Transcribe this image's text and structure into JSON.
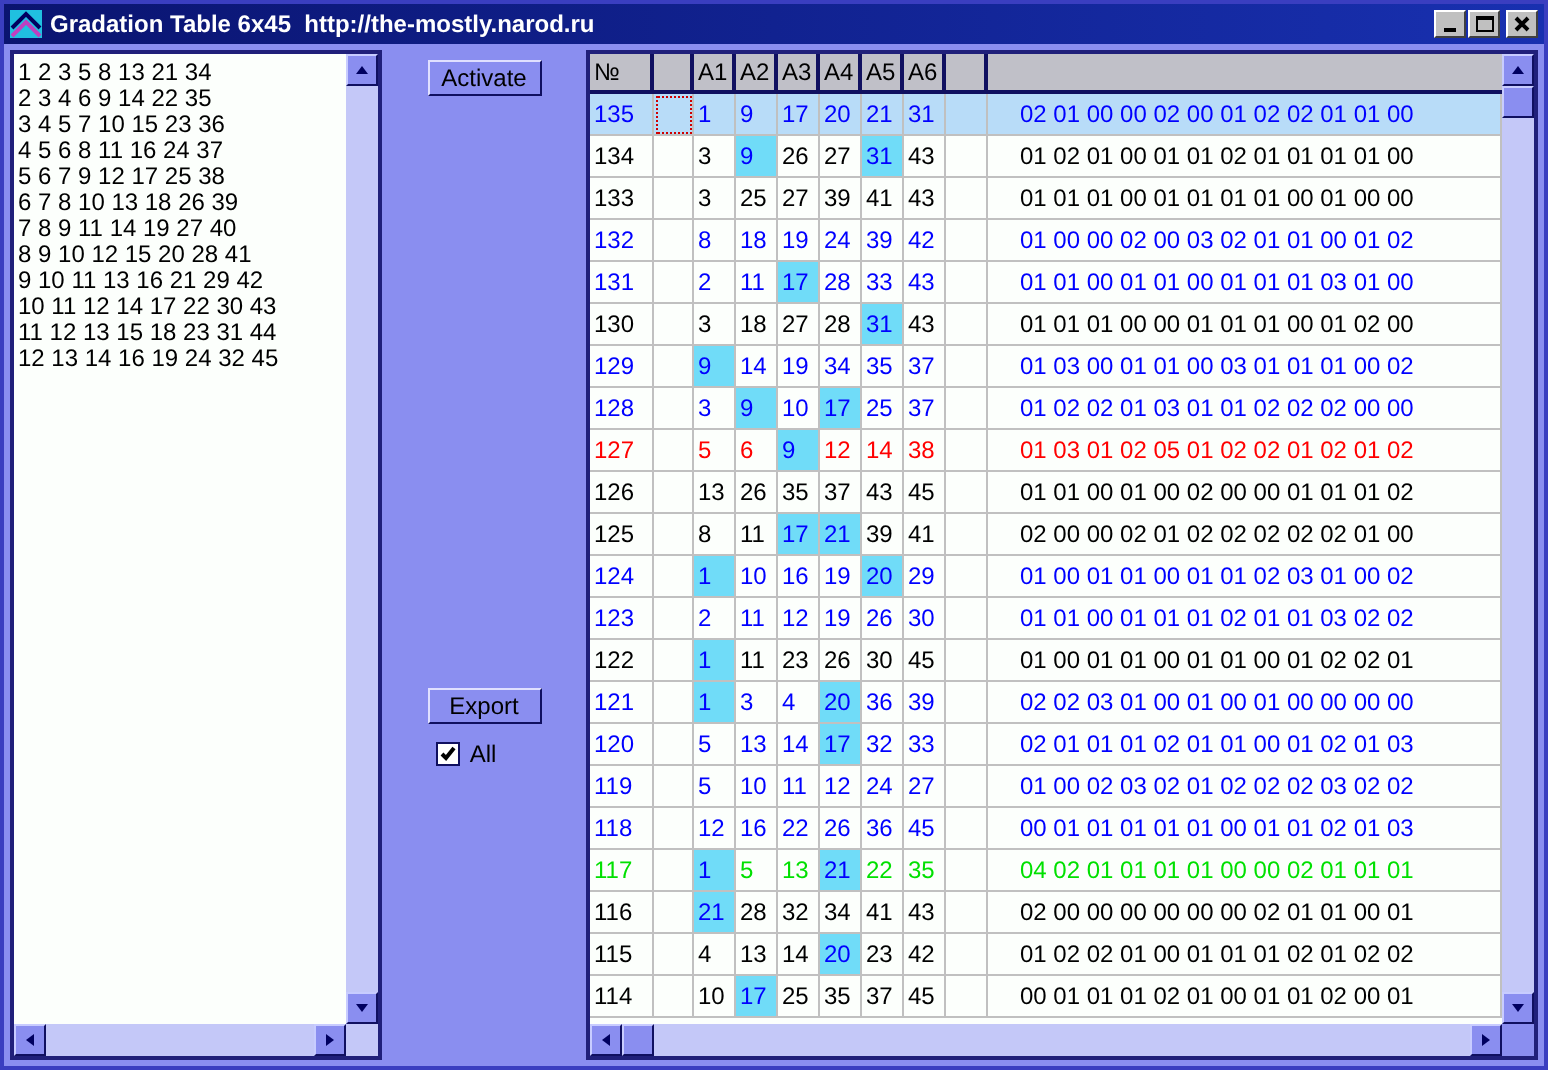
{
  "window": {
    "title": "Gradation Table 6x45  http://the-mostly.narod.ru"
  },
  "sequence_list": {
    "lines": [
      "1 2 3 5 8 13 21 34",
      "2 3 4 6 9 14 22 35",
      "3 4 5 7 10 15 23 36",
      "4 5 6 8 11 16 24 37",
      "5 6 7 9 12 17 25 38",
      "6 7 8 10 13 18 26 39",
      "7 8 9 11 14 19 27 40",
      "8 9 10 12 15 20 28 41",
      "9 10 11 13 16 21 29 42",
      "10 11 12 14 17 22 30 43",
      "11 12 13 15 18 23 31 44",
      "12 13 14 16 19 24 32 45"
    ]
  },
  "activate_button": "Activate",
  "export_button": "Export",
  "all_checkbox": {
    "label": "All",
    "checked": true
  },
  "table": {
    "columns": [
      "№",
      null,
      "A1",
      "A2",
      "A3",
      "A4",
      "A5",
      "A6",
      null,
      null
    ],
    "rows": [
      {
        "selected": true,
        "color": "#0000ff",
        "cells": [
          {
            "value": "135",
            "highlighted": false
          },
          {
            "highlighted": false
          },
          {
            "value": "1",
            "highlighted": false
          },
          {
            "value": "9",
            "highlighted": false
          },
          {
            "value": "17",
            "highlighted": false
          },
          {
            "value": "20",
            "highlighted": false
          },
          {
            "value": "21",
            "highlighted": false
          },
          {
            "value": "31",
            "highlighted": false
          },
          {
            "highlighted": false
          },
          {
            "value": "02 01 00 00 02 00 01 02 02 01 01 00",
            "highlighted": false
          }
        ]
      },
      {
        "selected": false,
        "color": "#000000",
        "cells": [
          {
            "value": "134",
            "highlighted": false
          },
          {
            "highlighted": false
          },
          {
            "value": "3",
            "highlighted": false
          },
          {
            "value": "9",
            "highlighted": true
          },
          {
            "value": "26",
            "highlighted": false
          },
          {
            "value": "27",
            "highlighted": false
          },
          {
            "value": "31",
            "highlighted": true
          },
          {
            "value": "43",
            "highlighted": false
          },
          {
            "highlighted": false
          },
          {
            "value": "01 02 01 00 01 01 02 01 01 01 01 00",
            "highlighted": false
          }
        ]
      },
      {
        "selected": false,
        "color": "#000000",
        "cells": [
          {
            "value": "133",
            "highlighted": false
          },
          {
            "highlighted": false
          },
          {
            "value": "3",
            "highlighted": false
          },
          {
            "value": "25",
            "highlighted": false
          },
          {
            "value": "27",
            "highlighted": false
          },
          {
            "value": "39",
            "highlighted": false
          },
          {
            "value": "41",
            "highlighted": false
          },
          {
            "value": "43",
            "highlighted": false
          },
          {
            "highlighted": false
          },
          {
            "value": "01 01 01 00 01 01 01 01 00 01 00 00",
            "highlighted": false
          }
        ]
      },
      {
        "selected": false,
        "color": "#0000ff",
        "cells": [
          {
            "value": "132",
            "highlighted": false
          },
          {
            "highlighted": false
          },
          {
            "value": "8",
            "highlighted": false
          },
          {
            "value": "18",
            "highlighted": false
          },
          {
            "value": "19",
            "highlighted": false
          },
          {
            "value": "24",
            "highlighted": false
          },
          {
            "value": "39",
            "highlighted": false
          },
          {
            "value": "42",
            "highlighted": false
          },
          {
            "highlighted": false
          },
          {
            "value": "01 00 00 02 00 03 02 01 01 00 01 02",
            "highlighted": false
          }
        ]
      },
      {
        "selected": false,
        "color": "#0000ff",
        "cells": [
          {
            "value": "131",
            "highlighted": false
          },
          {
            "highlighted": false
          },
          {
            "value": "2",
            "highlighted": false
          },
          {
            "value": "11",
            "highlighted": false
          },
          {
            "value": "17",
            "highlighted": true
          },
          {
            "value": "28",
            "highlighted": false
          },
          {
            "value": "33",
            "highlighted": false
          },
          {
            "value": "43",
            "highlighted": false
          },
          {
            "highlighted": false
          },
          {
            "value": "01 01 00 01 01 00 01 01 01 03 01 00",
            "highlighted": false
          }
        ]
      },
      {
        "selected": false,
        "color": "#000000",
        "cells": [
          {
            "value": "130",
            "highlighted": false
          },
          {
            "highlighted": false
          },
          {
            "value": "3",
            "highlighted": false
          },
          {
            "value": "18",
            "highlighted": false
          },
          {
            "value": "27",
            "highlighted": false
          },
          {
            "value": "28",
            "highlighted": false
          },
          {
            "value": "31",
            "highlighted": true
          },
          {
            "value": "43",
            "highlighted": false
          },
          {
            "highlighted": false
          },
          {
            "value": "01 01 01 00 00 01 01 01 00 01 02 00",
            "highlighted": false
          }
        ]
      },
      {
        "selected": false,
        "color": "#0000ff",
        "cells": [
          {
            "value": "129",
            "highlighted": false
          },
          {
            "highlighted": false
          },
          {
            "value": "9",
            "highlighted": true
          },
          {
            "value": "14",
            "highlighted": false
          },
          {
            "value": "19",
            "highlighted": false
          },
          {
            "value": "34",
            "highlighted": false
          },
          {
            "value": "35",
            "highlighted": false
          },
          {
            "value": "37",
            "highlighted": false
          },
          {
            "highlighted": false
          },
          {
            "value": "01 03 00 01 01 00 03 01 01 01 00 02",
            "highlighted": false
          }
        ]
      },
      {
        "selected": false,
        "color": "#0000ff",
        "cells": [
          {
            "value": "128",
            "highlighted": false
          },
          {
            "highlighted": false
          },
          {
            "value": "3",
            "highlighted": false
          },
          {
            "value": "9",
            "highlighted": true
          },
          {
            "value": "10",
            "highlighted": false
          },
          {
            "value": "17",
            "highlighted": true
          },
          {
            "value": "25",
            "highlighted": false
          },
          {
            "value": "37",
            "highlighted": false
          },
          {
            "highlighted": false
          },
          {
            "value": "01 02 02 01 03 01 01 02 02 02 00 00",
            "highlighted": false
          }
        ]
      },
      {
        "selected": false,
        "color": "#ff0000",
        "cells": [
          {
            "value": "127",
            "highlighted": false
          },
          {
            "highlighted": false
          },
          {
            "value": "5",
            "highlighted": false
          },
          {
            "value": "6",
            "highlighted": false
          },
          {
            "value": "9",
            "highlighted": true
          },
          {
            "value": "12",
            "highlighted": false
          },
          {
            "value": "14",
            "highlighted": false
          },
          {
            "value": "38",
            "highlighted": false
          },
          {
            "highlighted": false
          },
          {
            "value": "01 03 01 02 05 01 02 02 01 02 01 02",
            "highlighted": false
          }
        ]
      },
      {
        "selected": false,
        "color": "#000000",
        "cells": [
          {
            "value": "126",
            "highlighted": false
          },
          {
            "highlighted": false
          },
          {
            "value": "13",
            "highlighted": false
          },
          {
            "value": "26",
            "highlighted": false
          },
          {
            "value": "35",
            "highlighted": false
          },
          {
            "value": "37",
            "highlighted": false
          },
          {
            "value": "43",
            "highlighted": false
          },
          {
            "value": "45",
            "highlighted": false
          },
          {
            "highlighted": false
          },
          {
            "value": "01 01 00 01 00 02 00 00 01 01 01 02",
            "highlighted": false
          }
        ]
      },
      {
        "selected": false,
        "color": "#000000",
        "cells": [
          {
            "value": "125",
            "highlighted": false
          },
          {
            "highlighted": false
          },
          {
            "value": "8",
            "highlighted": false
          },
          {
            "value": "11",
            "highlighted": false
          },
          {
            "value": "17",
            "highlighted": true
          },
          {
            "value": "21",
            "highlighted": true
          },
          {
            "value": "39",
            "highlighted": false
          },
          {
            "value": "41",
            "highlighted": false
          },
          {
            "highlighted": false
          },
          {
            "value": "02 00 00 02 01 02 02 02 02 02 01 00",
            "highlighted": false
          }
        ]
      },
      {
        "selected": false,
        "color": "#0000ff",
        "cells": [
          {
            "value": "124",
            "highlighted": false
          },
          {
            "highlighted": false
          },
          {
            "value": "1",
            "highlighted": true
          },
          {
            "value": "10",
            "highlighted": false
          },
          {
            "value": "16",
            "highlighted": false
          },
          {
            "value": "19",
            "highlighted": false
          },
          {
            "value": "20",
            "highlighted": true
          },
          {
            "value": "29",
            "highlighted": false
          },
          {
            "highlighted": false
          },
          {
            "value": "01 00 01 01 00 01 01 02 03 01 00 02",
            "highlighted": false
          }
        ]
      },
      {
        "selected": false,
        "color": "#0000ff",
        "cells": [
          {
            "value": "123",
            "highlighted": false
          },
          {
            "highlighted": false
          },
          {
            "value": "2",
            "highlighted": false
          },
          {
            "value": "11",
            "highlighted": false
          },
          {
            "value": "12",
            "highlighted": false
          },
          {
            "value": "19",
            "highlighted": false
          },
          {
            "value": "26",
            "highlighted": false
          },
          {
            "value": "30",
            "highlighted": false
          },
          {
            "highlighted": false
          },
          {
            "value": "01 01 00 01 01 01 02 01 01 03 02 02",
            "highlighted": false
          }
        ]
      },
      {
        "selected": false,
        "color": "#000000",
        "cells": [
          {
            "value": "122",
            "highlighted": false
          },
          {
            "highlighted": false
          },
          {
            "value": "1",
            "highlighted": true
          },
          {
            "value": "11",
            "highlighted": false
          },
          {
            "value": "23",
            "highlighted": false
          },
          {
            "value": "26",
            "highlighted": false
          },
          {
            "value": "30",
            "highlighted": false
          },
          {
            "value": "45",
            "highlighted": false
          },
          {
            "highlighted": false
          },
          {
            "value": "01 00 01 01 00 01 01 00 01 02 02 01",
            "highlighted": false
          }
        ]
      },
      {
        "selected": false,
        "color": "#0000ff",
        "cells": [
          {
            "value": "121",
            "highlighted": false
          },
          {
            "highlighted": false
          },
          {
            "value": "1",
            "highlighted": true
          },
          {
            "value": "3",
            "highlighted": false
          },
          {
            "value": "4",
            "highlighted": false
          },
          {
            "value": "20",
            "highlighted": true
          },
          {
            "value": "36",
            "highlighted": false
          },
          {
            "value": "39",
            "highlighted": false
          },
          {
            "highlighted": false
          },
          {
            "value": "02 02 03 01 00 01 00 01 00 00 00 00",
            "highlighted": false
          }
        ]
      },
      {
        "selected": false,
        "color": "#0000ff",
        "cells": [
          {
            "value": "120",
            "highlighted": false
          },
          {
            "highlighted": false
          },
          {
            "value": "5",
            "highlighted": false
          },
          {
            "value": "13",
            "highlighted": false
          },
          {
            "value": "14",
            "highlighted": false
          },
          {
            "value": "17",
            "highlighted": true
          },
          {
            "value": "32",
            "highlighted": false
          },
          {
            "value": "33",
            "highlighted": false
          },
          {
            "highlighted": false
          },
          {
            "value": "02 01 01 01 02 01 01 00 01 02 01 03",
            "highlighted": false
          }
        ]
      },
      {
        "selected": false,
        "color": "#0000ff",
        "cells": [
          {
            "value": "119",
            "highlighted": false
          },
          {
            "highlighted": false
          },
          {
            "value": "5",
            "highlighted": false
          },
          {
            "value": "10",
            "highlighted": false
          },
          {
            "value": "11",
            "highlighted": false
          },
          {
            "value": "12",
            "highlighted": false
          },
          {
            "value": "24",
            "highlighted": false
          },
          {
            "value": "27",
            "highlighted": false
          },
          {
            "highlighted": false
          },
          {
            "value": "01 00 02 03 02 01 02 02 02 03 02 02",
            "highlighted": false
          }
        ]
      },
      {
        "selected": false,
        "color": "#0000ff",
        "cells": [
          {
            "value": "118",
            "highlighted": false
          },
          {
            "highlighted": false
          },
          {
            "value": "12",
            "highlighted": false
          },
          {
            "value": "16",
            "highlighted": false
          },
          {
            "value": "22",
            "highlighted": false
          },
          {
            "value": "26",
            "highlighted": false
          },
          {
            "value": "36",
            "highlighted": false
          },
          {
            "value": "45",
            "highlighted": false
          },
          {
            "highlighted": false
          },
          {
            "value": "00 01 01 01 01 01 00 01 01 02 01 03",
            "highlighted": false
          }
        ]
      },
      {
        "selected": false,
        "color": "#00e000",
        "cells": [
          {
            "value": "117",
            "highlighted": false
          },
          {
            "highlighted": false
          },
          {
            "value": "1",
            "highlighted": true
          },
          {
            "value": "5",
            "highlighted": false
          },
          {
            "value": "13",
            "highlighted": false
          },
          {
            "value": "21",
            "highlighted": true
          },
          {
            "value": "22",
            "highlighted": false
          },
          {
            "value": "35",
            "highlighted": false
          },
          {
            "highlighted": false
          },
          {
            "value": "04 02 01 01 01 01 00 00 02 01 01 01",
            "highlighted": false
          }
        ]
      },
      {
        "selected": false,
        "color": "#000000",
        "cells": [
          {
            "value": "116",
            "highlighted": false
          },
          {
            "highlighted": false
          },
          {
            "value": "21",
            "highlighted": true
          },
          {
            "value": "28",
            "highlighted": false
          },
          {
            "value": "32",
            "highlighted": false
          },
          {
            "value": "34",
            "highlighted": false
          },
          {
            "value": "41",
            "highlighted": false
          },
          {
            "value": "43",
            "highlighted": false
          },
          {
            "highlighted": false
          },
          {
            "value": "02 00 00 00 00 00 00 02 01 01 00 01",
            "highlighted": false
          }
        ]
      },
      {
        "selected": false,
        "color": "#000000",
        "cells": [
          {
            "value": "115",
            "highlighted": false
          },
          {
            "highlighted": false
          },
          {
            "value": "4",
            "highlighted": false
          },
          {
            "value": "13",
            "highlighted": false
          },
          {
            "value": "14",
            "highlighted": false
          },
          {
            "value": "20",
            "highlighted": true
          },
          {
            "value": "23",
            "highlighted": false
          },
          {
            "value": "42",
            "highlighted": false
          },
          {
            "highlighted": false
          },
          {
            "value": "01 02 02 01 00 01 01 01 02 01 02 02",
            "highlighted": false
          }
        ]
      },
      {
        "selected": false,
        "color": "#000000",
        "cells": [
          {
            "value": "114",
            "highlighted": false
          },
          {
            "highlighted": false
          },
          {
            "value": "10",
            "highlighted": false
          },
          {
            "value": "17",
            "highlighted": true
          },
          {
            "value": "25",
            "highlighted": false
          },
          {
            "value": "35",
            "highlighted": false
          },
          {
            "value": "37",
            "highlighted": false
          },
          {
            "value": "45",
            "highlighted": false
          },
          {
            "highlighted": false
          },
          {
            "value": "00 01 01 01 02 01 00 01 01 02 00 01",
            "highlighted": false
          }
        ]
      }
    ]
  }
}
